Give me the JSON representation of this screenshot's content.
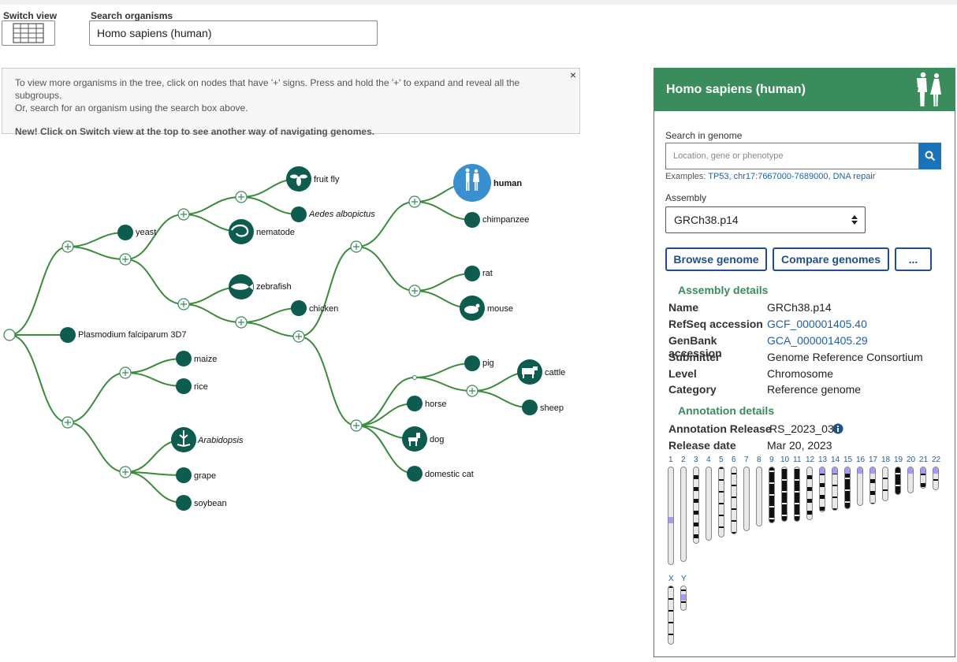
{
  "header": {
    "switch_view_label": "Switch view",
    "search_label": "Search organisms",
    "search_value": "Homo sapiens (human)"
  },
  "info": {
    "line1": "To view more organisms in the tree, click on nodes that have '+' signs. Press and hold the '+' to expand and reveal all the subgroups.",
    "line2": "Or, search for an organism using the search box above.",
    "new_text": "New! Click on Switch view at the top to see another way of navigating genomes.",
    "close": "×"
  },
  "tree": {
    "labels": {
      "fruit_fly": "fruit fly",
      "aedes": "Aedes albopictus",
      "yeast": "yeast",
      "nematode": "nematode",
      "zebrafish": "zebrafish",
      "chicken": "chicken",
      "plasmodium": "Plasmodium falciparum 3D7",
      "maize": "maize",
      "rice": "rice",
      "arabidopsis": "Arabidopsis",
      "grape": "grape",
      "soybean": "soybean",
      "human": "human",
      "chimpanzee": "chimpanzee",
      "rat": "rat",
      "mouse": "mouse",
      "pig": "pig",
      "cattle": "cattle",
      "sheep": "sheep",
      "horse": "horse",
      "dog": "dog",
      "domestic_cat": "domestic cat"
    }
  },
  "panel": {
    "title": "Homo sapiens (human)",
    "search_label": "Search in genome",
    "search_placeholder": "Location, gene or phenotype",
    "examples_prefix": "Examples: ",
    "examples_links": "TP53, chr17:7667000-7689000, DNA repair",
    "assembly_label": "Assembly",
    "assembly_value": "GRCh38.p14",
    "buttons": {
      "browse": "Browse genome",
      "compare": "Compare genomes",
      "more": "..."
    },
    "assembly_details": {
      "title": "Assembly details",
      "rows": [
        {
          "k": "Name",
          "v": "GRCh38.p14"
        },
        {
          "k": "RefSeq accession",
          "v": "GCF_000001405.40"
        },
        {
          "k": "GenBank accession",
          "v": "GCA_000001405.29"
        },
        {
          "k": "Submitter",
          "v": "Genome Reference Consortium"
        },
        {
          "k": "Level",
          "v": "Chromosome"
        },
        {
          "k": "Category",
          "v": "Reference genome"
        }
      ]
    },
    "annotation_details": {
      "title": "Annotation details",
      "rows": [
        {
          "k": "Annotation Release",
          "v": "RS_2023_03"
        },
        {
          "k": "Release date",
          "v": "Mar 20, 2023"
        }
      ]
    },
    "chromosomes": [
      "1",
      "2",
      "3",
      "4",
      "5",
      "6",
      "7",
      "8",
      "9",
      "10",
      "11",
      "12",
      "13",
      "14",
      "15",
      "16",
      "17",
      "18",
      "19",
      "20",
      "21",
      "22"
    ],
    "sex_chromosomes": [
      "X",
      "Y"
    ]
  },
  "colors": {
    "green": "#3a8c5c",
    "tree_node": "#0d5c4f",
    "link_blue": "#1f5fa7",
    "button_blue": "#1f4f8f",
    "human_node": "#3a8fcf"
  }
}
